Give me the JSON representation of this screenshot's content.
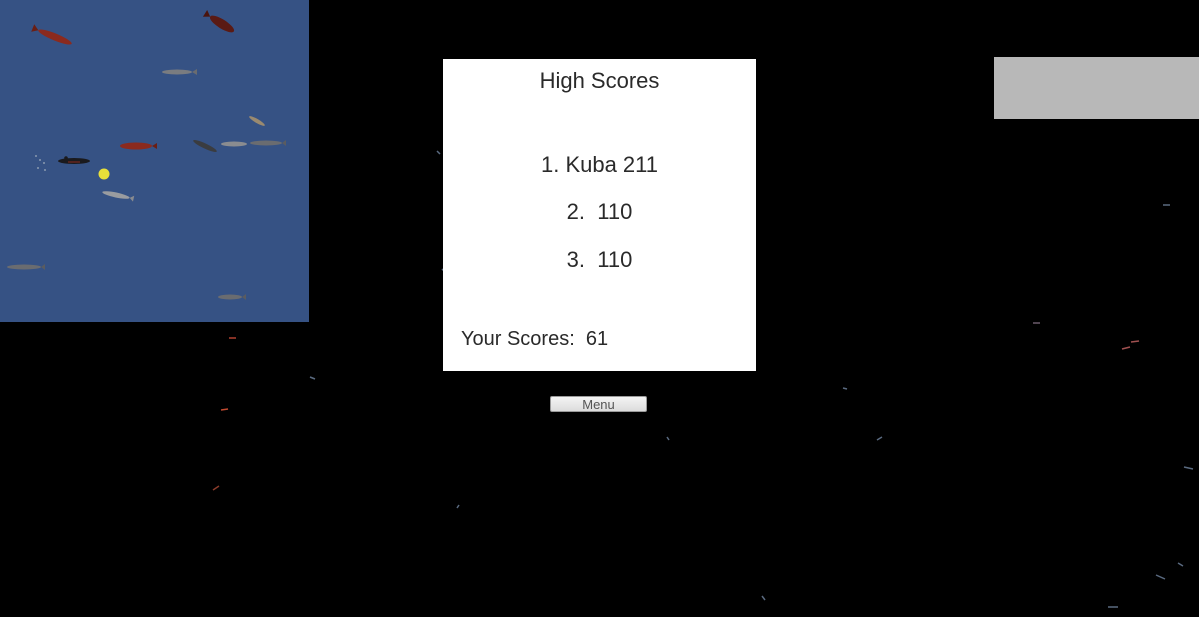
{
  "high_scores": {
    "title": "High Scores",
    "entries": [
      {
        "text": "1. Kuba 211"
      },
      {
        "text": "2.  110"
      },
      {
        "text": "3.  110"
      }
    ],
    "your_score_label": "Your Scores:  61"
  },
  "menu_button": {
    "label": "Menu"
  },
  "minimap": {
    "background": "#365284",
    "player_color": "#e8e03a"
  },
  "colors": {
    "panel": "#ffffff",
    "corner_box": "#b8b8b8",
    "background": "#000000"
  }
}
